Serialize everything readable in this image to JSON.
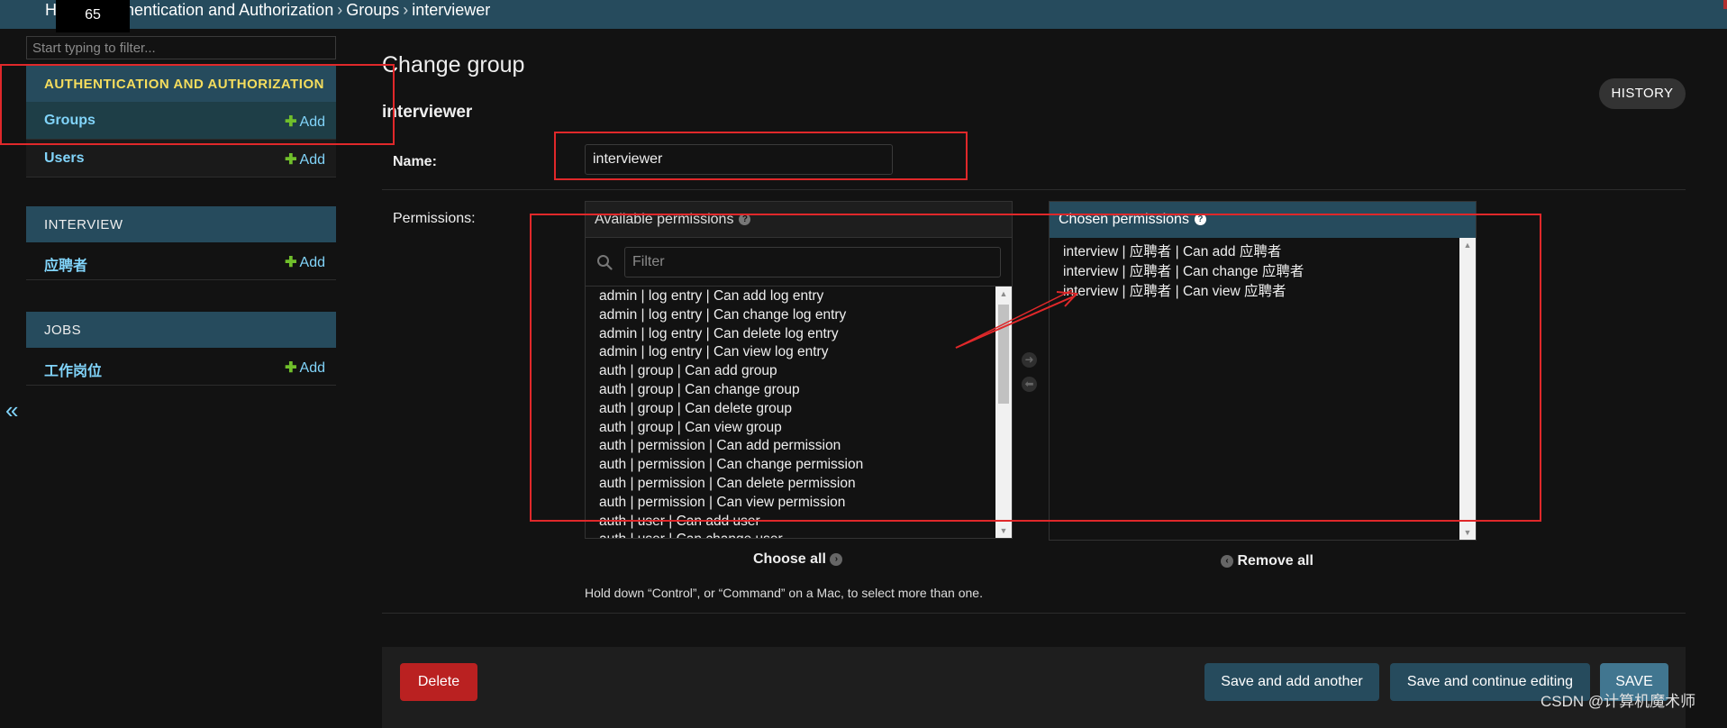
{
  "header": {
    "crumbs": [
      "Home",
      "Authentication and Authorization",
      "Groups",
      "interviewer"
    ],
    "crumb_sep": "›",
    "tooltip_value": "65"
  },
  "sidebar": {
    "filter_placeholder": "Start typing to filter...",
    "collapse_glyph": "«",
    "modules": [
      {
        "caption": "AUTHENTICATION AND AUTHORIZATION",
        "models": [
          {
            "name": "Groups",
            "add": "Add"
          },
          {
            "name": "Users",
            "add": "Add"
          }
        ]
      },
      {
        "caption": "INTERVIEW",
        "models": [
          {
            "name": "应聘者",
            "add": "Add"
          }
        ]
      },
      {
        "caption": "JOBS",
        "models": [
          {
            "name": "工作岗位",
            "add": "Add"
          }
        ]
      }
    ]
  },
  "content": {
    "title": "Change group",
    "history": "HISTORY",
    "object_name": "interviewer",
    "name_label": "Name:",
    "name_value": "interviewer",
    "permissions_label": "Permissions:",
    "available": {
      "title": "Available permissions",
      "filter_placeholder": "Filter",
      "items": [
        "admin | log entry | Can add log entry",
        "admin | log entry | Can change log entry",
        "admin | log entry | Can delete log entry",
        "admin | log entry | Can view log entry",
        "auth | group | Can add group",
        "auth | group | Can change group",
        "auth | group | Can delete group",
        "auth | group | Can view group",
        "auth | permission | Can add permission",
        "auth | permission | Can change permission",
        "auth | permission | Can delete permission",
        "auth | permission | Can view permission",
        "auth | user | Can add user",
        "auth | user | Can change user"
      ],
      "choose_all": "Choose all"
    },
    "chosen": {
      "title": "Chosen permissions",
      "items": [
        "interview | 应聘者 | Can add 应聘者",
        "interview | 应聘者 | Can change 应聘者",
        "interview | 应聘者 | Can view 应聘者"
      ],
      "remove_all": "Remove all"
    },
    "help_text": "Hold down “Control”, or “Command” on a Mac, to select more than one."
  },
  "buttons": {
    "delete": "Delete",
    "save_add_another": "Save and add another",
    "save_continue": "Save and continue editing",
    "save": "SAVE"
  },
  "watermark": "CSDN @计算机魔术师",
  "colors": {
    "header": "#264b5d",
    "link": "#81d4fa",
    "caption_accent": "#f5dd5d",
    "add_plus": "#70bf2b",
    "delete": "#ba2121",
    "annotation": "#e0282a"
  },
  "icons": [
    "search-icon",
    "help-icon",
    "choose-arrow-icon",
    "remove-arrow-icon",
    "plus-icon",
    "collapse-icon"
  ]
}
